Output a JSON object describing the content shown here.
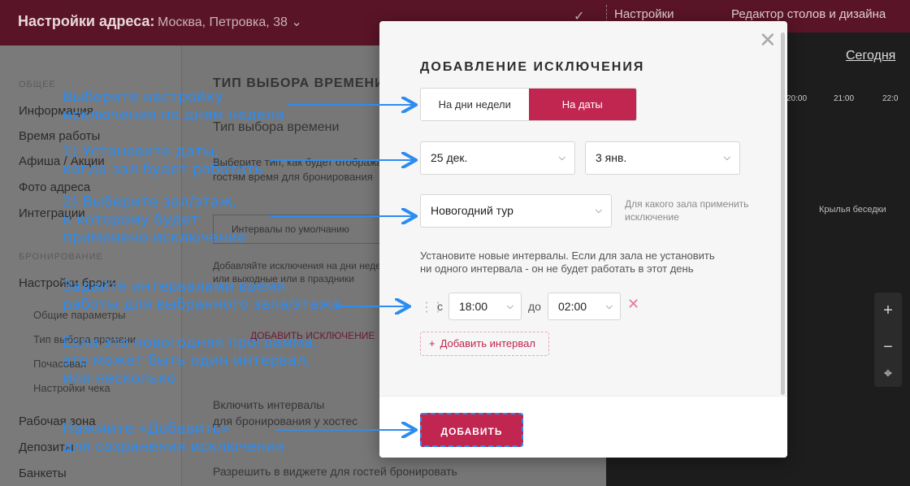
{
  "topbar": {
    "title": "Настройки адреса:",
    "address": "Москва, Петровка, 38 ⌄",
    "settings": "Настройки",
    "editor": "Редактор столов и дизайна"
  },
  "sidebar": {
    "section_general": "ОБЩЕЕ",
    "items": [
      "Информация",
      "Время работы",
      "Афиша / Акции",
      "Фото адреса",
      "Интеграции"
    ],
    "section_booking": "БРОНИРОВАНИЕ",
    "booking_settings": "Настройки брони",
    "subitems": [
      "Общие параметры",
      "Тип выбора времени",
      "Почасовая",
      "Настройки чека"
    ],
    "more": [
      "Рабочая зона",
      "Депозиты",
      "Банкеты"
    ]
  },
  "mainbg": {
    "heading": "ТИП ВЫБОРА ВРЕМЕНИ",
    "subheading": "Тип выбора времени",
    "desc1": "Выберите тип, как будет отображаться",
    "desc2": "гостям время для бронирования",
    "intervals_default": "Интервалы по умолчанию",
    "add_exc_desc1": "Добавляйте исключения на дни недели",
    "add_exc_desc2": "или выходные или в праздники",
    "add_exception_link": "ДОБАВИТЬ ИСКЛЮЧЕНИЕ",
    "enable1": "Включить интервалы",
    "enable2": "для бронирования у хостес",
    "widget": "Разрешить в виджете для гостей бронировать"
  },
  "rightbg": {
    "today": "Сегодня",
    "times": [
      "20:00",
      "21:00",
      "22:0"
    ],
    "zone": "Крылья беседки",
    "zoom_in": "+",
    "zoom_out": "−",
    "locate": "⌖"
  },
  "modal": {
    "title": "ДОБАВЛЕНИЕ ИСКЛЮЧЕНИЯ",
    "close": "✕",
    "seg_weekdays": "На дни недели",
    "seg_dates": "На даты",
    "date_from": "25 дек.",
    "date_to": "3 янв.",
    "hall": "Новогодний тур",
    "hall_hint": "Для какого зала применить исключение",
    "note": "Установите новые интервалы. Если для зала не установить ни одного интервала - он не будет работать в этот день",
    "from_label": "с",
    "time_from": "18:00",
    "to_label": "до",
    "time_to": "02:00",
    "delete": "✕",
    "add_interval": "Добавить интервал",
    "add_button": "ДОБАВИТЬ"
  },
  "annotations": {
    "a1": [
      "Выберите настройку",
      "исключения по дням недели"
    ],
    "a2": [
      "1) Установите даты,",
      "когда зал будет работать"
    ],
    "a3": [
      "2) Выберите зал/этаж,",
      "к которому будет",
      "применено исключение"
    ],
    "a4": [
      "Задайте интервалами время",
      "работы для выбранного зала/этажа"
    ],
    "a5": [
      "Если это новогодняя программа,",
      "это может быть один интервал,",
      "или несколько"
    ],
    "a6": [
      "Нажмите «Добавить»",
      "для сохранения исключения"
    ]
  },
  "colors": {
    "accent": "#c0264f",
    "annotation": "#2d8cf0"
  }
}
